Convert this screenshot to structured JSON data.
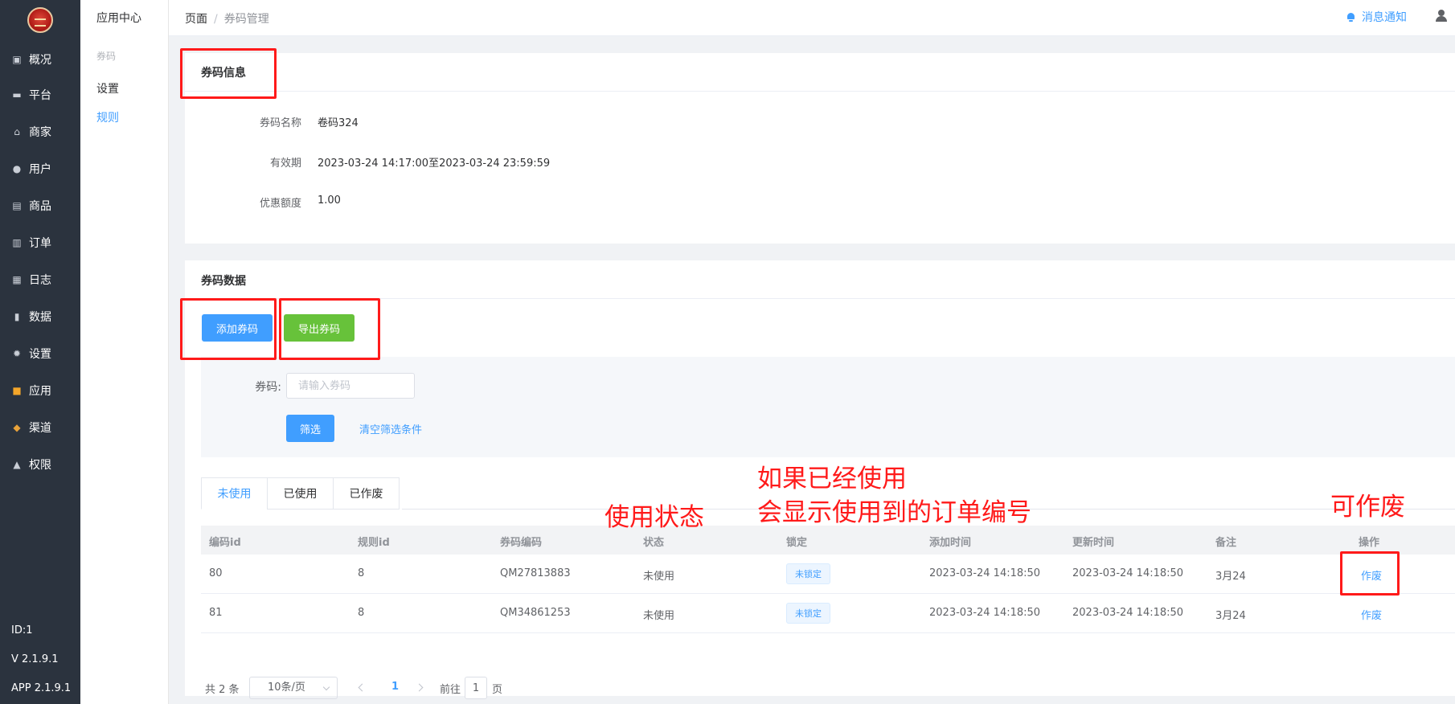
{
  "sidebar": {
    "items": [
      {
        "label": "概况",
        "icon": "dashboard-icon",
        "glyph": "▣"
      },
      {
        "label": "平台",
        "icon": "monitor-icon",
        "glyph": "▬"
      },
      {
        "label": "商家",
        "icon": "store-icon",
        "glyph": "⌂"
      },
      {
        "label": "用户",
        "icon": "user-icon",
        "glyph": "●"
      },
      {
        "label": "商品",
        "icon": "goods-icon",
        "glyph": "▤"
      },
      {
        "label": "订单",
        "icon": "order-icon",
        "glyph": "▥"
      },
      {
        "label": "日志",
        "icon": "log-icon",
        "glyph": "▦"
      },
      {
        "label": "数据",
        "icon": "chart-icon",
        "glyph": "▮"
      },
      {
        "label": "设置",
        "icon": "gear-icon",
        "glyph": "✹"
      },
      {
        "label": "应用",
        "icon": "apps-icon",
        "glyph": "■"
      },
      {
        "label": "渠道",
        "icon": "cube-icon",
        "glyph": "◆"
      },
      {
        "label": "权限",
        "icon": "lock-icon",
        "glyph": "▲"
      }
    ],
    "footer": {
      "id": "ID:1",
      "version": "V 2.1.9.1",
      "app_version": "APP 2.1.9.1"
    }
  },
  "subbar": {
    "title": "应用中心",
    "group": "券码",
    "items": [
      {
        "label": "设置",
        "active": false
      },
      {
        "label": "规则",
        "active": true
      }
    ]
  },
  "header": {
    "breadcrumb": [
      "页面",
      "券码管理"
    ],
    "separator": "/",
    "notice": "消息通知"
  },
  "info_card": {
    "title": "券码信息",
    "fields": [
      {
        "label": "券码名称",
        "value": "卷码324"
      },
      {
        "label": "有效期",
        "value": "2023-03-24 14:17:00至2023-03-24 23:59:59"
      },
      {
        "label": "优惠额度",
        "value": "1.00"
      }
    ]
  },
  "data_card": {
    "title": "券码数据",
    "add_button": "添加券码",
    "export_button": "导出券码",
    "filter": {
      "label": "券码:",
      "placeholder": "请输入券码",
      "value": "",
      "submit": "筛选",
      "clear": "清空筛选条件"
    },
    "tabs": [
      {
        "label": "未使用",
        "active": true
      },
      {
        "label": "已使用",
        "active": false
      },
      {
        "label": "已作废",
        "active": false
      }
    ],
    "table": {
      "columns": [
        "编码id",
        "规则id",
        "券码编码",
        "状态",
        "锁定",
        "添加时间",
        "更新时间",
        "备注",
        "操作"
      ],
      "rows": [
        {
          "id": "80",
          "rule_id": "8",
          "code": "QM27813883",
          "status": "未使用",
          "lock": "未锁定",
          "created": "2023-03-24 14:18:50",
          "updated": "2023-03-24 14:18:50",
          "remark": "3月24",
          "action": "作废"
        },
        {
          "id": "81",
          "rule_id": "8",
          "code": "QM34861253",
          "status": "未使用",
          "lock": "未锁定",
          "created": "2023-03-24 14:18:50",
          "updated": "2023-03-24 14:18:50",
          "remark": "3月24",
          "action": "作废"
        }
      ]
    },
    "pagination": {
      "total": "共 2 条",
      "page_size": "10条/页",
      "current": "1",
      "goto_label": "前往",
      "goto_value": "1",
      "page_suffix": "页"
    }
  },
  "annotations": {
    "status_note": "使用状态",
    "used_note_line1": "如果已经使用",
    "used_note_line2": "会显示使用到的订单编号",
    "void_note": "可作废",
    "color": "#ff1a1a"
  },
  "colors": {
    "primary": "#409eff",
    "success": "#67c23a",
    "sidebar": "#2b333e"
  }
}
